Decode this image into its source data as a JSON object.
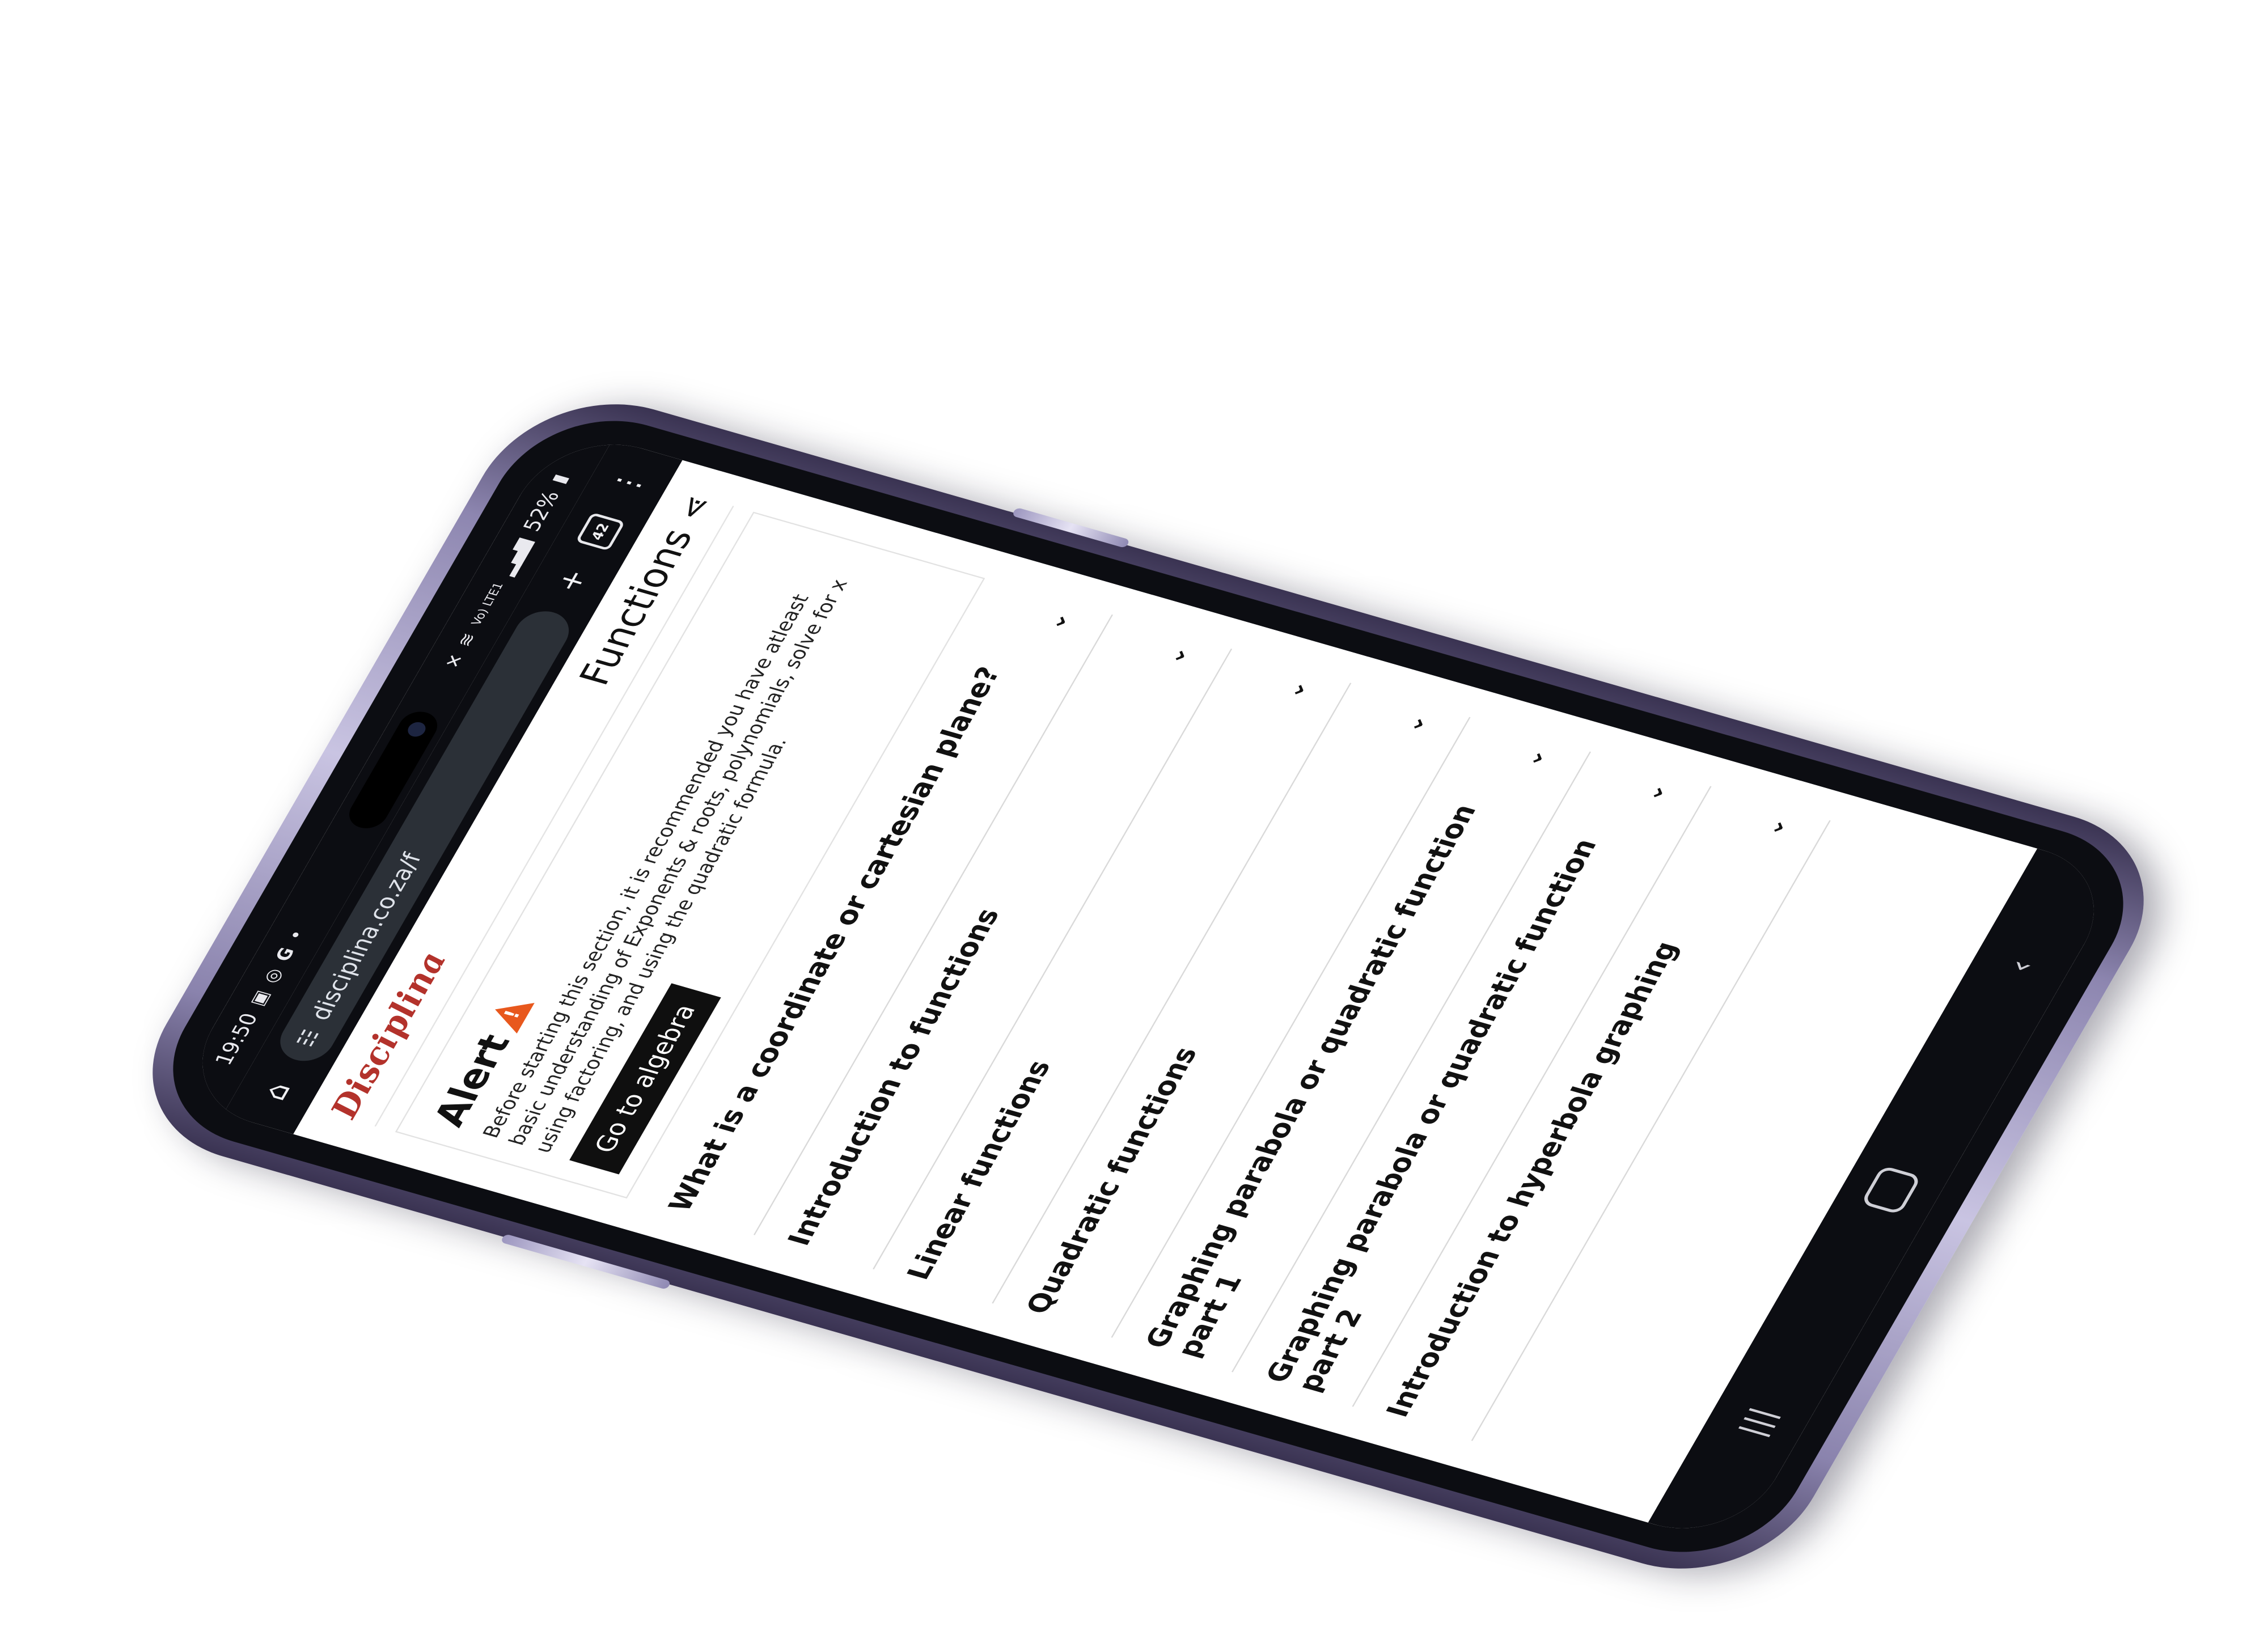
{
  "status_bar": {
    "time": "19:50",
    "left_icons": [
      "image-icon",
      "whatsapp-icon",
      "google-icon",
      "dot-icon"
    ],
    "network": "Vo) LTE1",
    "battery": "52%"
  },
  "browser": {
    "url": "disciplina.co.za/f",
    "tab_count": "42"
  },
  "site": {
    "logo": "Disciplina",
    "page_title": "Functions"
  },
  "alert": {
    "title": "Alert",
    "text": "Before starting this section, it is recommended you have atleast basic understanding of Exponents & roots, polynomials, solve for x using factoring, and using the quadratic formula.",
    "button": "Go to algebra"
  },
  "topics": [
    "What is a coordinate or cartesian plane?",
    "Introduction to functions",
    "Linear functions",
    "Quadratic functions",
    "Graphing parabola or quadratic function part 1",
    "Graphing parabola or quadratic function part 2",
    "Introduction to hyperbola graphing"
  ],
  "colors": {
    "brand": "#b3322b",
    "alert_icon": "#e8581d",
    "phone_frame": "#8a83ad",
    "browser_chrome": "#0c0d12"
  }
}
